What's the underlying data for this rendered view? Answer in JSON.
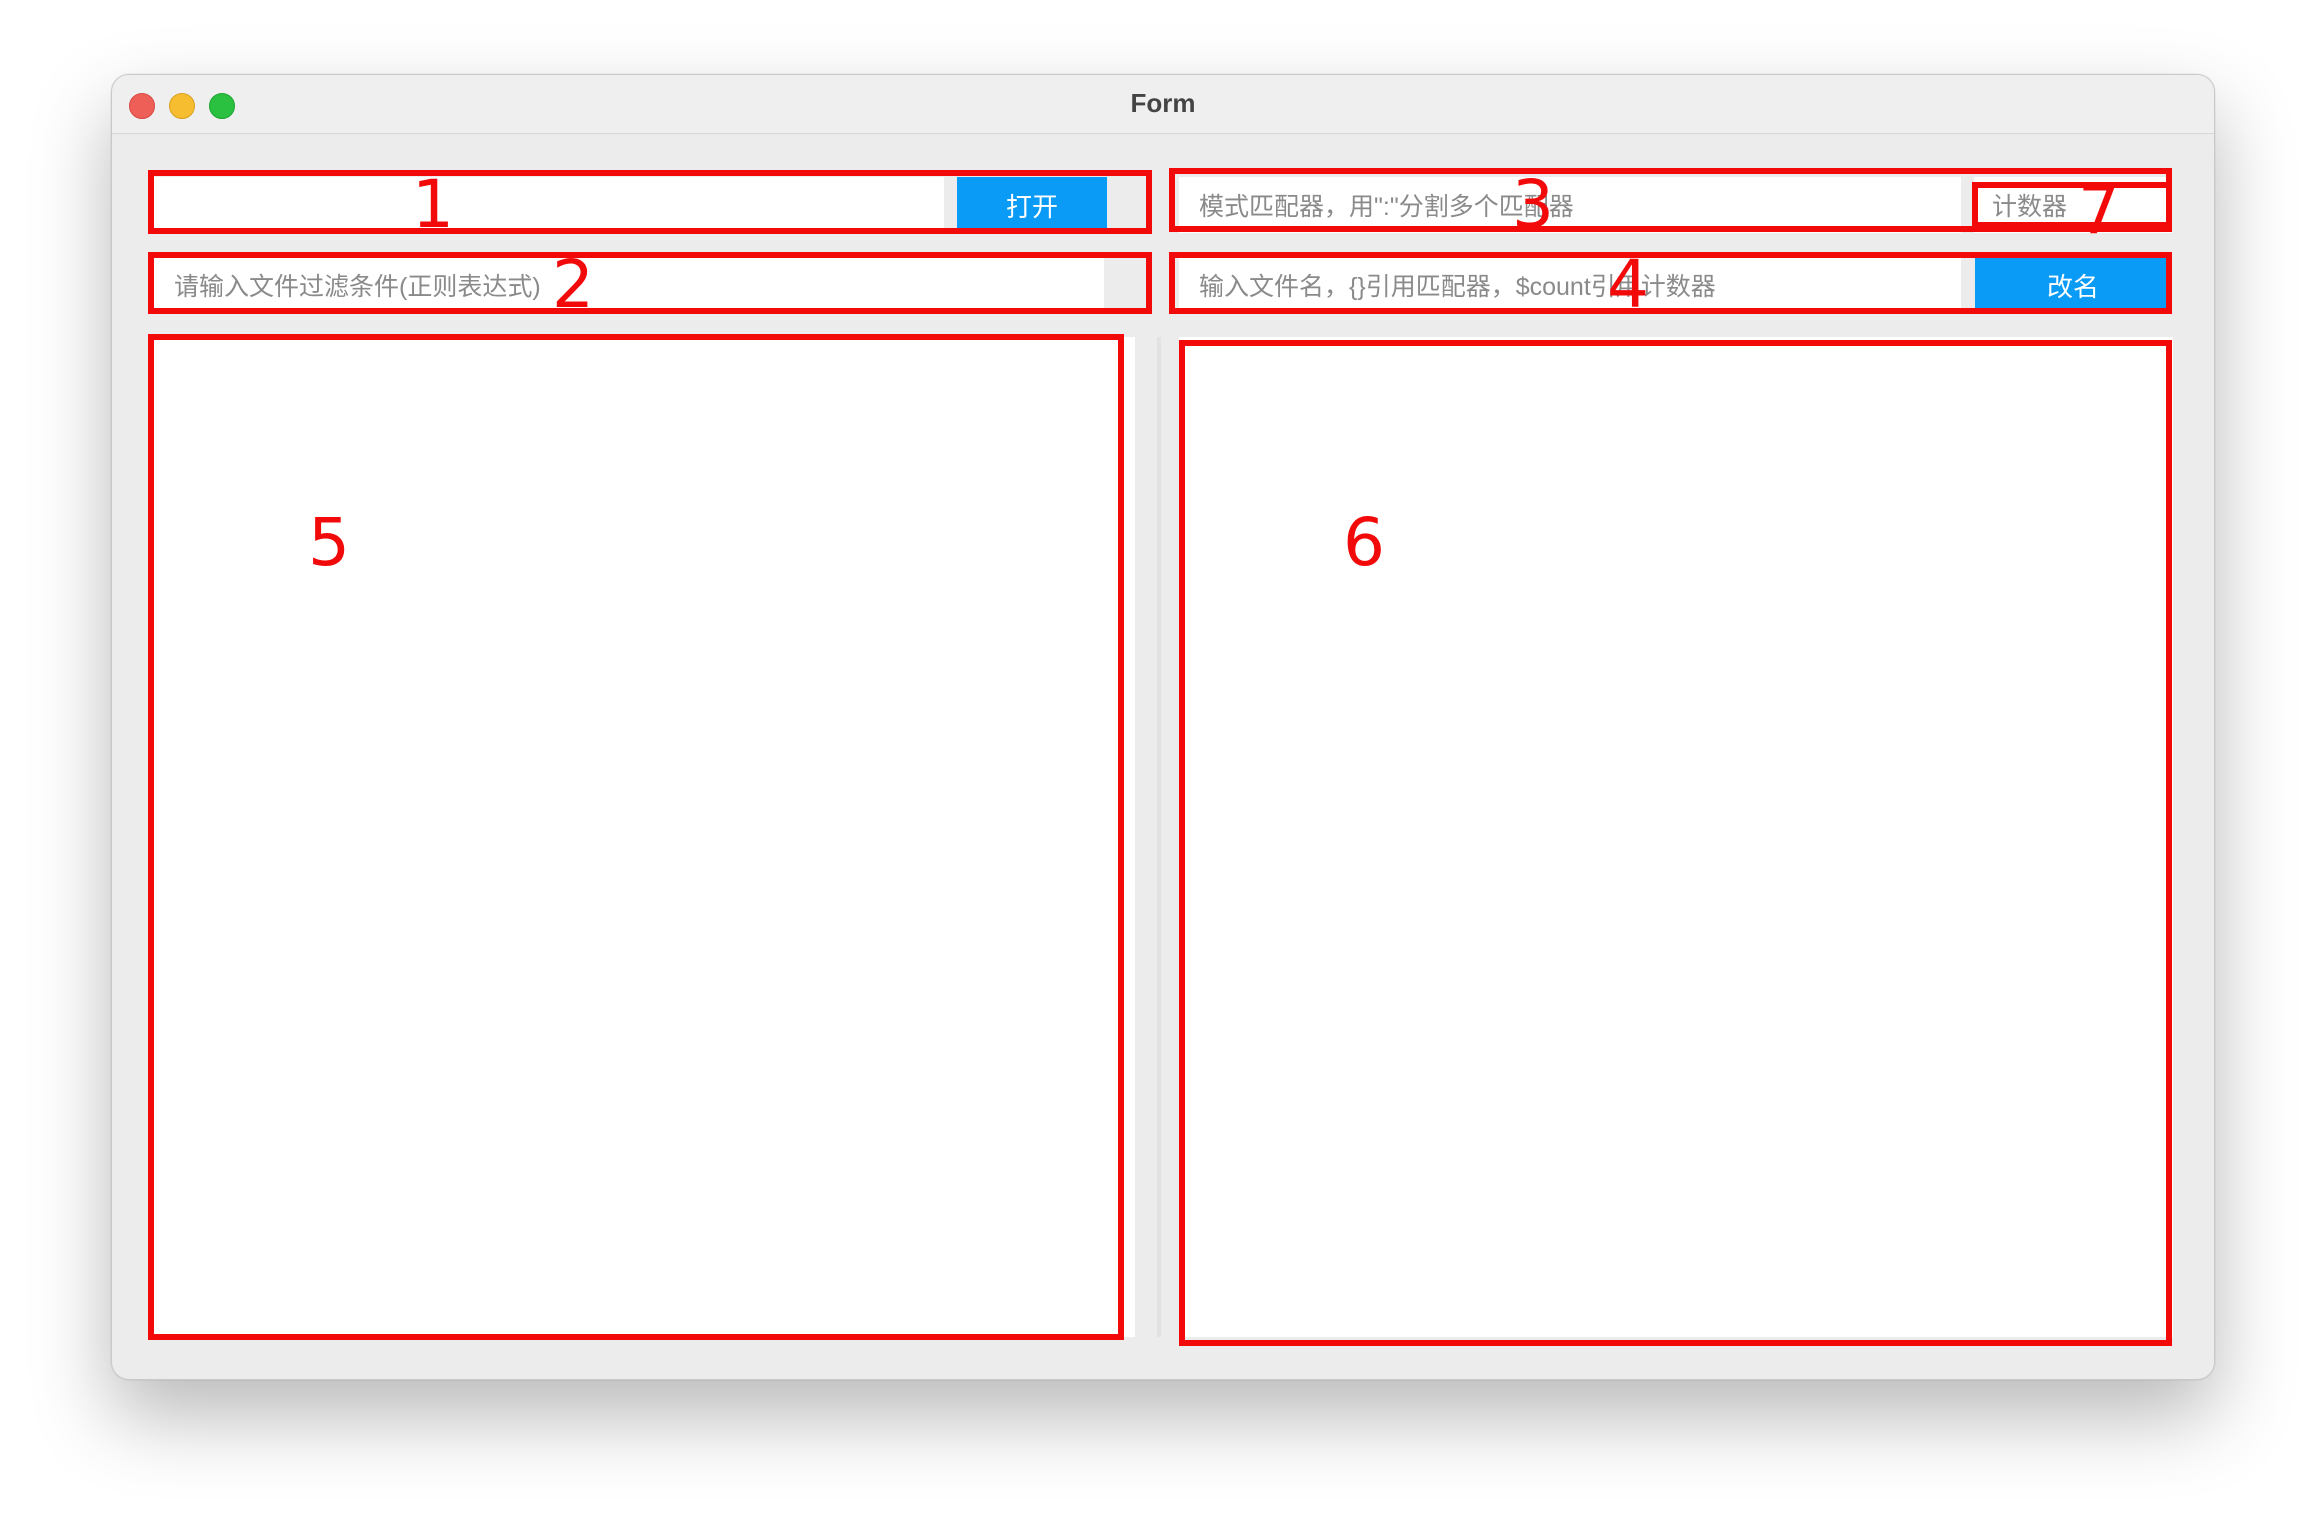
{
  "window": {
    "title": "Form"
  },
  "toolbar": {
    "path_input_value": "",
    "open_button_label": "打开",
    "pattern_placeholder": "模式匹配器，用\":\"分割多个匹配器",
    "counter_placeholder": "计数器",
    "filter_placeholder": "请输入文件过滤条件(正则表达式)",
    "rename_placeholder": "输入文件名，{}引用匹配器，$count引用计数器",
    "rename_button_label": "改名"
  },
  "annotations": [
    "1",
    "2",
    "3",
    "4",
    "5",
    "6",
    "7"
  ],
  "colors": {
    "accent": "#0a9bf6",
    "annotation": "#f20a0a",
    "window_bg": "#ececec"
  }
}
